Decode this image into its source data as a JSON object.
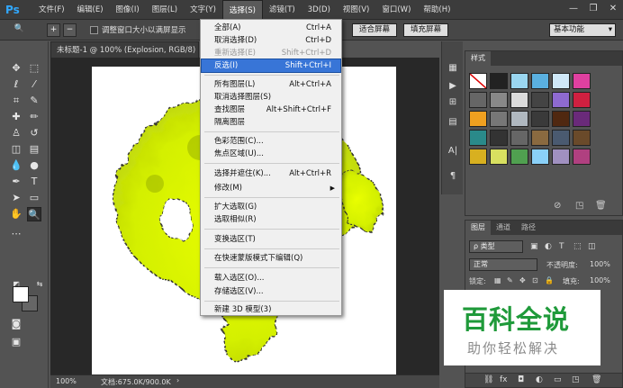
{
  "app": {
    "logo": "Ps"
  },
  "menubar": {
    "items": [
      "文件(F)",
      "编辑(E)",
      "图像(I)",
      "图层(L)",
      "文字(Y)",
      "选择(S)",
      "滤镜(T)",
      "3D(D)",
      "视图(V)",
      "窗口(W)",
      "帮助(H)"
    ],
    "active_index": 5
  },
  "window_buttons": {
    "minimize": "—",
    "restore": "❐",
    "close": "✕"
  },
  "options_bar": {
    "checkbox1_label": "调整窗口大小以满屏显示",
    "fit_screen": "适合屏幕",
    "fill_screen": "填充屏幕",
    "workspace": "基本功能"
  },
  "document": {
    "tab_title": "未标题-1 @ 100% (Explosion, RGB/8) *",
    "zoom": "100%",
    "doc_info": "文档:675.0K/900.0K"
  },
  "select_menu": {
    "items": [
      {
        "label": "全部(A)",
        "shortcut": "Ctrl+A"
      },
      {
        "label": "取消选择(D)",
        "shortcut": "Ctrl+D"
      },
      {
        "label": "重新选择(E)",
        "shortcut": "Shift+Ctrl+D",
        "disabled": true
      },
      {
        "label": "反选(I)",
        "shortcut": "Shift+Ctrl+I",
        "highlighted": true
      },
      {
        "label": "所有图层(L)",
        "shortcut": "Alt+Ctrl+A"
      },
      {
        "label": "取消选择图层(S)",
        "shortcut": ""
      },
      {
        "label": "查找图层",
        "shortcut": "Alt+Shift+Ctrl+F"
      },
      {
        "label": "隔离图层",
        "shortcut": ""
      },
      {
        "label": "色彩范围(C)...",
        "shortcut": ""
      },
      {
        "label": "焦点区域(U)...",
        "shortcut": ""
      },
      {
        "label": "选择并遮住(K)...",
        "shortcut": "Alt+Ctrl+R"
      },
      {
        "label": "修改(M)",
        "shortcut": ""
      },
      {
        "label": "扩大选取(G)",
        "shortcut": ""
      },
      {
        "label": "选取相似(R)",
        "shortcut": ""
      },
      {
        "label": "变换选区(T)",
        "shortcut": ""
      },
      {
        "label": "在快速蒙版模式下编辑(Q)",
        "shortcut": ""
      },
      {
        "label": "载入选区(O)...",
        "shortcut": ""
      },
      {
        "label": "存储选区(V)...",
        "shortcut": ""
      },
      {
        "label": "新建 3D 模型(3)",
        "shortcut": ""
      }
    ]
  },
  "styles_panel": {
    "tab": "样式"
  },
  "layers_panel": {
    "tabs": [
      "图层",
      "通道",
      "路径"
    ],
    "kind_filter": "ρ 类型",
    "blend_mode": "正常",
    "opacity_label": "不透明度:",
    "opacity_value": "100%",
    "lock_label": "锁定:",
    "fill_label": "填充:",
    "fill_value": "100%"
  },
  "watermark": {
    "title": "百科全说",
    "subtitle": "助你轻松解决"
  },
  "colors": {
    "accent": "#3875d7",
    "selection_fill": "#e6f500",
    "brand_green": "#1f9a3a"
  }
}
